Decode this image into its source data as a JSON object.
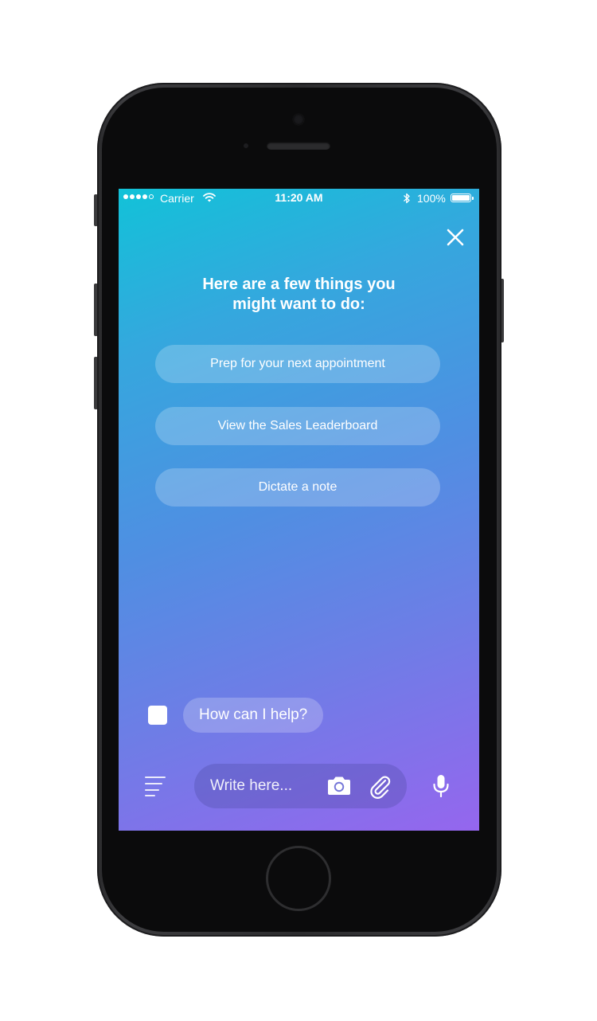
{
  "status_bar": {
    "carrier": "Carrier",
    "time": "11:20 AM",
    "battery_percent": "100%",
    "battery_level": 1.0,
    "signal_bars": 4,
    "signal_max": 5
  },
  "header": {
    "close_icon": "close-icon"
  },
  "prompt": {
    "title_line1": "Here are a few things you",
    "title_line2": "might want to do:"
  },
  "suggestions": [
    {
      "label": "Prep for your next appointment"
    },
    {
      "label": "View the Sales Leaderboard"
    },
    {
      "label": "Dictate a note"
    }
  ],
  "chat": {
    "bot_message": "How can I help?"
  },
  "composer": {
    "placeholder": "Write here...",
    "value": "",
    "icons": [
      "menu-icon",
      "camera-icon",
      "paperclip-icon",
      "microphone-icon"
    ]
  },
  "colors": {
    "gradient_start": "#12c2d8",
    "gradient_mid": "#4f8fe2",
    "gradient_end": "#9566ee",
    "text": "#ffffff"
  }
}
